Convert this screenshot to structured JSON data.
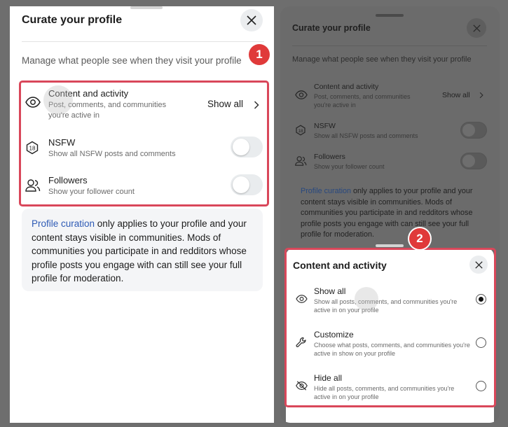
{
  "left_panel": {
    "title": "Curate your profile",
    "subtitle": "Manage what people see when they visit your profile",
    "rows": [
      {
        "title": "Content and activity",
        "desc": "Post, comments, and communities you're active in",
        "value": "Show all"
      },
      {
        "title": "NSFW",
        "desc": "Show all NSFW posts and comments",
        "toggle_on": false
      },
      {
        "title": "Followers",
        "desc": "Show your follower count",
        "toggle_on": false
      }
    ],
    "info": {
      "link_text": "Profile curation",
      "text": " only applies to your profile and your content stays visible in communities. Mods of communities you participate in and redditors whose profile posts you engage with can still see your full profile for moderation."
    },
    "badge": "1"
  },
  "right_panel": {
    "title": "Curate your profile",
    "subtitle": "Manage what people see when they visit your profile",
    "rows": [
      {
        "title": "Content and activity",
        "desc": "Post, comments, and communities you're active in",
        "value": "Show all"
      },
      {
        "title": "NSFW",
        "desc": "Show all NSFW posts and comments",
        "toggle_on": false
      },
      {
        "title": "Followers",
        "desc": "Show your follower count",
        "toggle_on": false
      }
    ],
    "info": {
      "link_text": "Profile curation",
      "text": " only applies to your profile and your content stays visible in communities. Mods of communities you participate in and redditors whose profile posts you engage with can still see your full profile for moderation."
    },
    "badge": "2",
    "sheet": {
      "title": "Content and activity",
      "options": [
        {
          "title": "Show all",
          "desc": "Show all posts, comments, and communities you're active in on your profile",
          "selected": true
        },
        {
          "title": "Customize",
          "desc": "Choose what posts, comments, and communities you're active in show on your profile",
          "selected": false
        },
        {
          "title": "Hide all",
          "desc": "Hide all posts, comments, and communities you're active in on your profile",
          "selected": false
        }
      ]
    }
  },
  "colors": {
    "highlight_border": "#d9475a",
    "badge": "#e03a3a",
    "link": "#2d5ab5"
  }
}
